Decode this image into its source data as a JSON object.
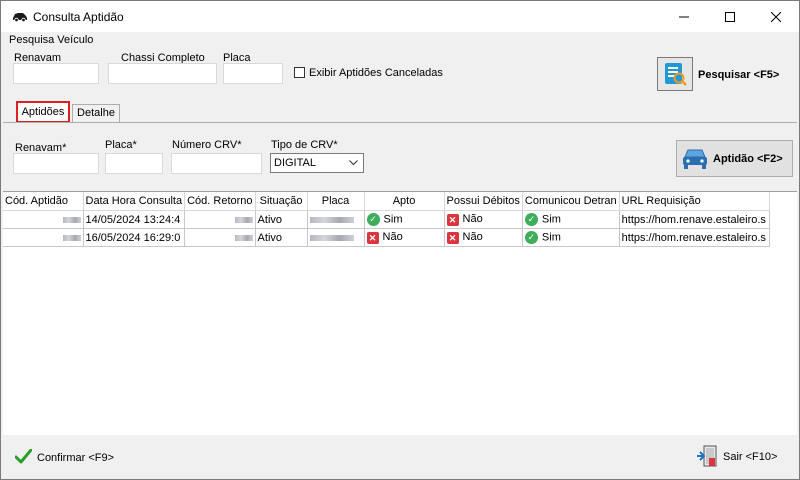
{
  "window": {
    "title": "Consulta Aptidão"
  },
  "search": {
    "group_label": "Pesquisa Veículo",
    "renavam_label": "Renavam",
    "renavam_value": "",
    "chassi_label": "Chassi Completo",
    "chassi_value": "",
    "placa_label": "Placa",
    "placa_value": "",
    "cancel_checkbox_label": "Exibir Aptidões Canceladas",
    "search_button_label": "Pesquisar <F5>"
  },
  "tabs": [
    {
      "label": "Aptidões",
      "active": true
    },
    {
      "label": "Detalhe",
      "active": false
    }
  ],
  "aptidao_form": {
    "renavam_label": "Renavam*",
    "placa_label": "Placa*",
    "crv_label": "Número CRV*",
    "tipo_crv_label": "Tipo de CRV*",
    "tipo_crv_value": "DIGITAL",
    "aptidao_button_label": "Aptidão <F2>"
  },
  "grid": {
    "columns": [
      "Cód. Aptidão",
      "Data Hora Consulta",
      "Cód. Retorno",
      "Situação",
      "Placa",
      "Apto",
      "Possui Débitos",
      "Comunicou Detran",
      "URL Requisição"
    ],
    "rows": [
      {
        "data_hora": "14/05/2024 13:24:4",
        "situacao": "Ativo",
        "apto": "Sim",
        "apto_ok": true,
        "debitos": "Não",
        "comunicou": "Sim",
        "url": "https://hom.renave.estaleiro.s"
      },
      {
        "data_hora": "16/05/2024 16:29:0",
        "situacao": "Ativo",
        "apto": "Não",
        "apto_ok": false,
        "debitos": "Não",
        "comunicou": "Sim",
        "url": "https://hom.renave.estaleiro.s"
      }
    ]
  },
  "footer": {
    "confirm_label": "Confirmar <F9>",
    "exit_label": "Sair <F10>"
  },
  "colors": {
    "active_tab_outline": "#e02020",
    "ok_green": "#3fae5a",
    "no_red": "#d9363e"
  }
}
